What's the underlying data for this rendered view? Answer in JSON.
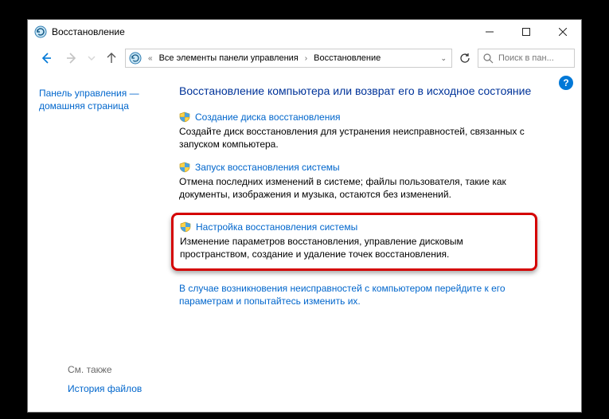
{
  "window": {
    "title": "Восстановление"
  },
  "nav": {
    "crumb1": "Все элементы панели управления",
    "crumb2": "Восстановление",
    "search_placeholder": "Поиск в пан..."
  },
  "sidebar": {
    "home_link": "Панель управления — домашняя страница",
    "see_also_label": "См. также",
    "see_also_link": "История файлов"
  },
  "main": {
    "heading": "Восстановление компьютера или возврат его в исходное состояние",
    "items": [
      {
        "title": "Создание диска восстановления",
        "desc": "Создайте диск восстановления для устранения неисправностей, связанных с запуском компьютера."
      },
      {
        "title": "Запуск восстановления системы",
        "desc": "Отмена последних изменений в системе; файлы пользователя, такие как документы, изображения и музыка, остаются без изменений."
      },
      {
        "title": "Настройка восстановления системы",
        "desc": "Изменение параметров восстановления, управление дисковым пространством, создание и удаление точек восстановления."
      }
    ],
    "footer_link": "В случае возникновения неисправностей с компьютером перейдите к его параметрам и попытайтесь изменить их."
  },
  "help": {
    "glyph": "?"
  }
}
